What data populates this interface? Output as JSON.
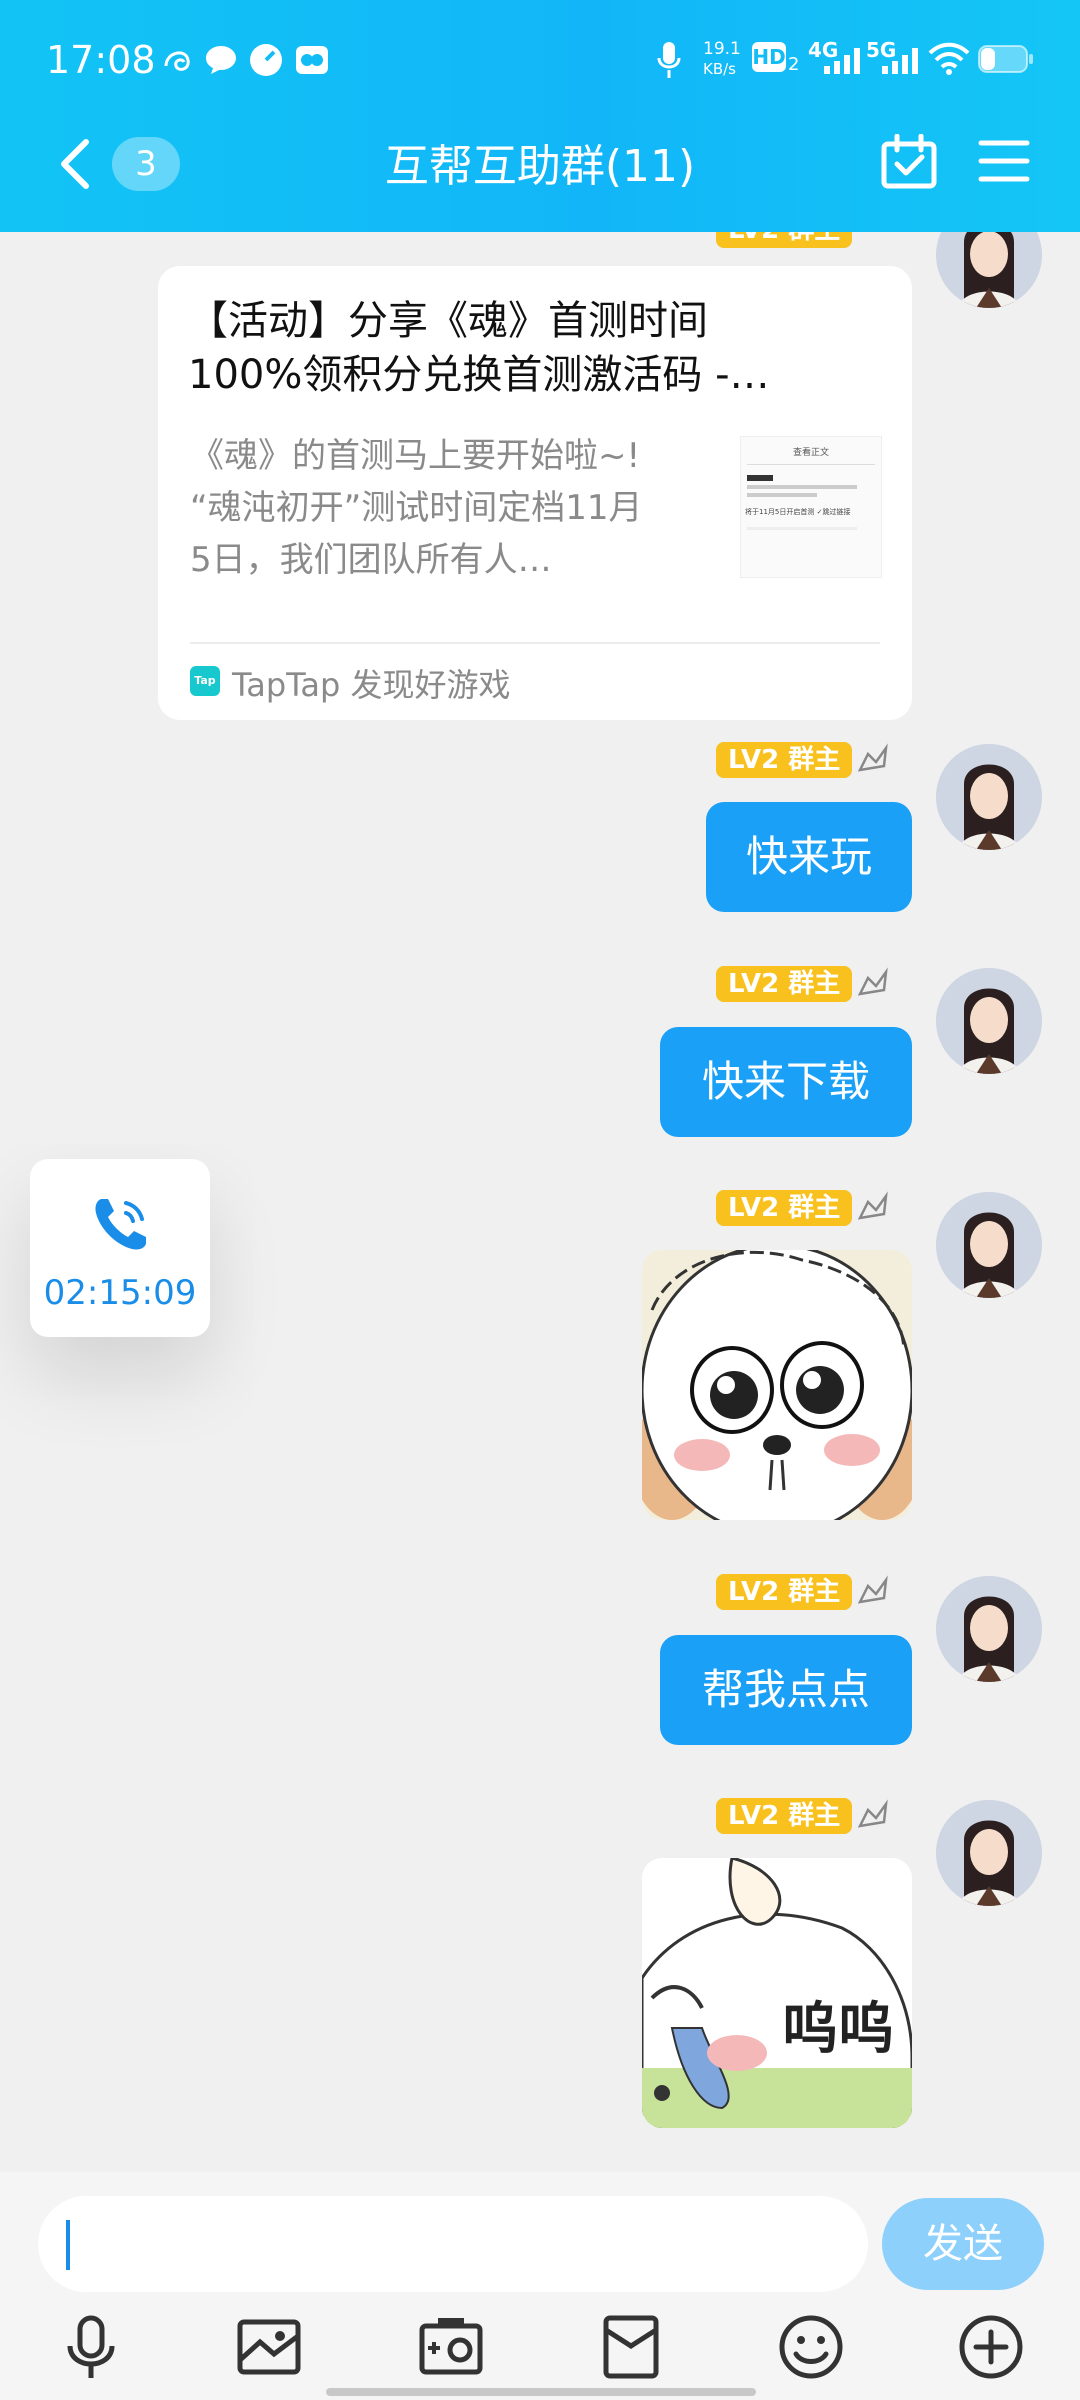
{
  "status_bar": {
    "time": "17:08",
    "net_speed_value": "19.1",
    "net_speed_unit": "KB/s",
    "hd_label": "HD",
    "hd_sub": "2",
    "sig1_label": "4G",
    "sig2_label": "5G"
  },
  "header": {
    "title": "互帮互助群(11)",
    "unread_count": "3"
  },
  "chat": {
    "share_card": {
      "title": "【活动】分享《魂》首测时间100%领积分兑换首测激活码 -…",
      "title_line1": "【活动】分享《魂》首测时间",
      "title_line2": "100%领积分兑换首测激活码 -…",
      "desc_line1": "《魂》的首测马上要开始啦~!",
      "desc_line2": "“魂沌初开”测试时间定档11月",
      "desc_line3": "5日，我们团队所有人…",
      "thumb_header": "查看正文",
      "thumb_line": "将于11月5日开启首测 ✓跳过链接",
      "source_icon_text": "Tap",
      "source_label": "TapTap 发现好游戏"
    },
    "sender_badge": "LV2 群主",
    "messages": [
      {
        "type": "text",
        "text": "快来玩"
      },
      {
        "type": "text",
        "text": "快来下载"
      },
      {
        "type": "sticker",
        "name": "crying-sheep-sticker"
      },
      {
        "type": "text",
        "text": "帮我点点"
      },
      {
        "type": "sticker",
        "name": "wuwu-sticker",
        "sticker_text": "呜呜"
      }
    ]
  },
  "call_widget": {
    "duration": "02:15:09"
  },
  "input": {
    "placeholder": "",
    "send_label": "发送"
  },
  "toolbar": {
    "items": [
      "mic-icon",
      "photo-icon",
      "camera-icon",
      "red-packet-icon",
      "emoji-icon",
      "plus-icon"
    ]
  },
  "colors": {
    "accent": "#1aa0f6",
    "header": "#12bdf6",
    "badge": "#f9c11d",
    "send_disabled": "#8cd0fb"
  }
}
